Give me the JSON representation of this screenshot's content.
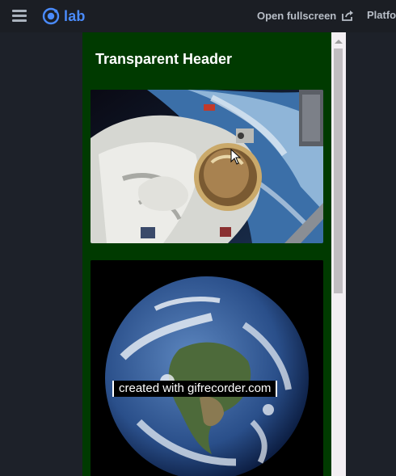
{
  "topbar": {
    "logo_text": "lab",
    "fullscreen_label": "Open fullscreen",
    "platform_label": "Platfo"
  },
  "header": {
    "title": "Transparent Header"
  },
  "cards": [
    {
      "image": "astronaut-spacewalk-photo"
    },
    {
      "image": "earth-globe-photo"
    }
  ],
  "watermark": "created with gifrecorder.com",
  "colors": {
    "topbar_bg": "#1b1e24",
    "page_bg": "#1d2129",
    "accent": "#4a8bfc",
    "device_bg": "#003a00"
  }
}
